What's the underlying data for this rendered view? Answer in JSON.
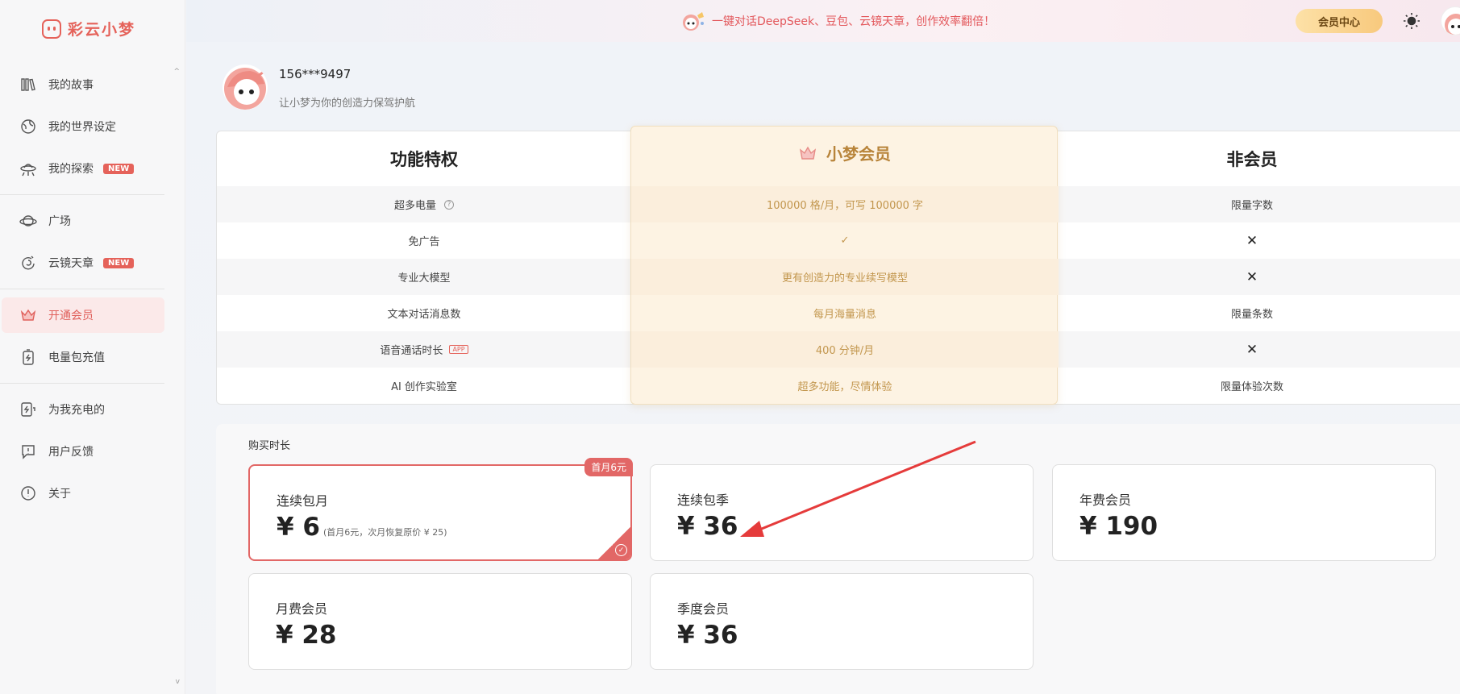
{
  "app": {
    "name": "彩云小梦"
  },
  "sidebar": {
    "items": [
      {
        "label": "我的故事",
        "icon": "books-icon"
      },
      {
        "label": "我的世界设定",
        "icon": "globe-icon"
      },
      {
        "label": "我的探索",
        "icon": "ufo-icon",
        "badge": "NEW"
      },
      {
        "label": "广场",
        "icon": "planet-icon"
      },
      {
        "label": "云镜天章",
        "icon": "swirl-icon",
        "badge": "NEW"
      },
      {
        "label": "开通会员",
        "icon": "crown-icon",
        "active": true
      },
      {
        "label": "电量包充值",
        "icon": "battery-icon"
      },
      {
        "label": "为我充电的",
        "icon": "charge-icon"
      },
      {
        "label": "用户反馈",
        "icon": "feedback-icon"
      },
      {
        "label": "关于",
        "icon": "info-icon"
      }
    ]
  },
  "topbar": {
    "promo": "一键对话DeepSeek、豆包、云镜天章，创作效率翻倍！",
    "vip_button": "会员中心"
  },
  "user": {
    "name": "156***9497",
    "subtitle": "让小梦为你的创造力保驾护航"
  },
  "compare": {
    "headers": {
      "feature": "功能特权",
      "vip": "小梦会员",
      "non": "非会员"
    },
    "rows": [
      {
        "feature": "超多电量",
        "vip": "100000 格/月，可写 100000 字",
        "non": "限量字数"
      },
      {
        "feature": "免广告",
        "vip": "✓",
        "non": "✕"
      },
      {
        "feature": "专业大模型",
        "vip": "更有创造力的专业续写模型",
        "non": "✕"
      },
      {
        "feature": "文本对话消息数",
        "vip": "每月海量消息",
        "non": "限量条数"
      },
      {
        "feature": "语音通话时长",
        "feature_tag": "APP",
        "vip": "400 分钟/月",
        "non": "✕"
      },
      {
        "feature": "AI 创作实验室",
        "vip": "超多功能，尽情体验",
        "non": "限量体验次数"
      }
    ]
  },
  "purchase": {
    "label": "购买时长",
    "plans": [
      {
        "name": "连续包月",
        "price": "¥ 6",
        "note": "(首月6元，次月恢复原价 ¥ 25)",
        "tag": "首月6元",
        "selected": true
      },
      {
        "name": "连续包季",
        "price": "¥ 36"
      },
      {
        "name": "年费会员",
        "price": "¥ 190"
      },
      {
        "name": "月费会员",
        "price": "¥ 28"
      },
      {
        "name": "季度会员",
        "price": "¥ 36"
      }
    ]
  },
  "colors": {
    "accent": "#e5625a",
    "gold": "#c2964d",
    "vip_bg": "#fdf3e3"
  }
}
